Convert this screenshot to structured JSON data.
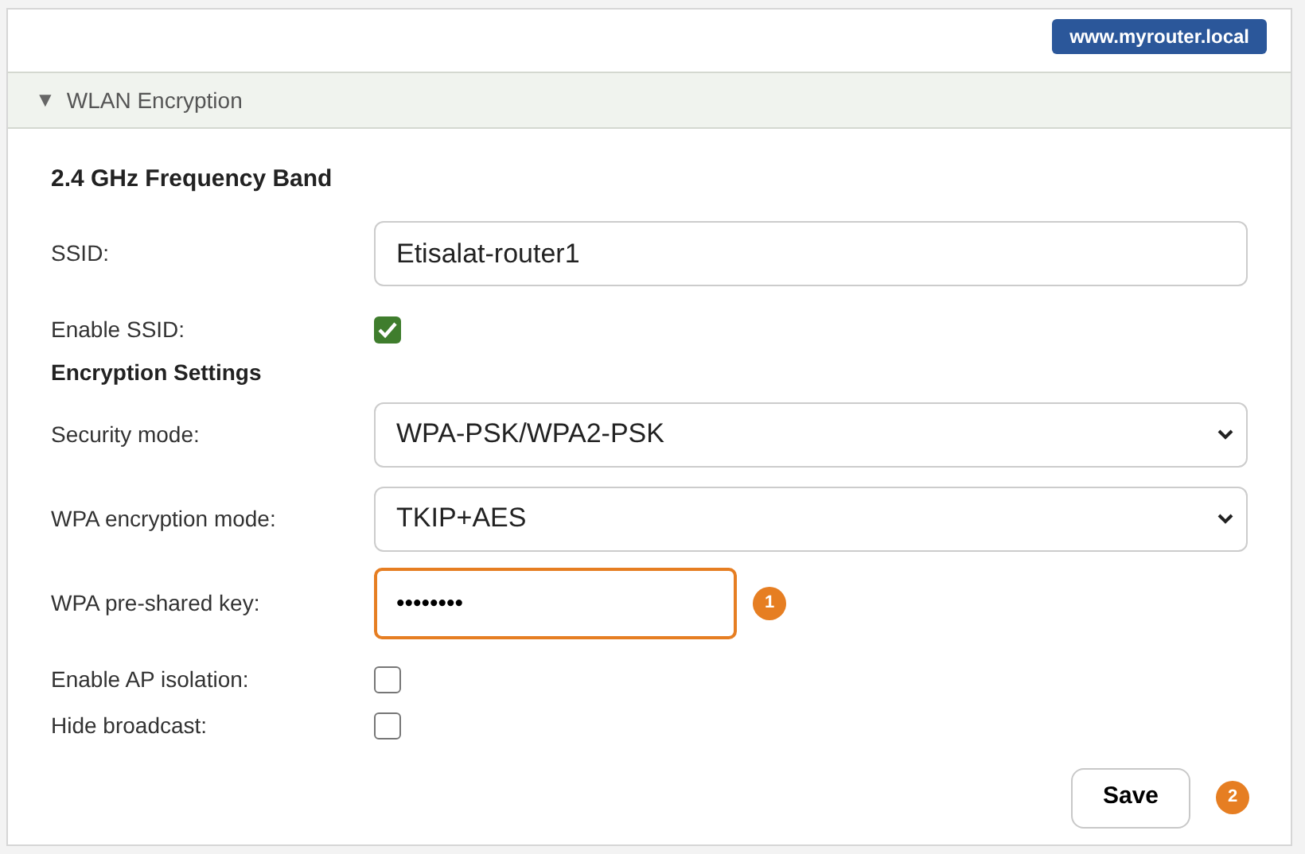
{
  "url_badge": "www.myrouter.local",
  "section": {
    "title": "WLAN Encryption",
    "expanded": true,
    "arrow": "▼"
  },
  "band_heading": "2.4 GHz Frequency Band",
  "rows": [
    {
      "kind": "text",
      "label": "SSID:",
      "value": "Etisalat-router1",
      "highlighted": false
    },
    {
      "kind": "checkbox",
      "label": "Enable SSID:",
      "checked": true
    },
    {
      "kind": "heading",
      "label": "Encryption Settings"
    },
    {
      "kind": "select",
      "label": "Security mode:",
      "value": "WPA-PSK/WPA2-PSK"
    },
    {
      "kind": "select",
      "label": "WPA encryption mode:",
      "value": "TKIP+AES"
    },
    {
      "kind": "text",
      "label": "WPA pre-shared key:",
      "value": "••••••••",
      "highlighted": true,
      "marker": "1"
    },
    {
      "kind": "checkbox",
      "label": "Enable AP isolation:",
      "checked": false
    },
    {
      "kind": "checkbox",
      "label": "Hide broadcast:",
      "checked": false
    }
  ],
  "save_button": {
    "label": "Save",
    "marker": "2"
  }
}
